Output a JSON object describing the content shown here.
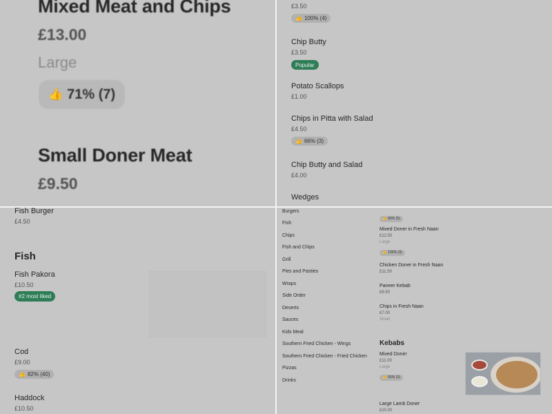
{
  "q1": {
    "item1": {
      "name": "Mixed Meat and Chips",
      "price": "£13.00",
      "size": "Large",
      "rating": "71% (7)"
    },
    "item2": {
      "name": "Small Doner Meat",
      "price": "£9.50"
    }
  },
  "q2": {
    "item0": {
      "price": "£3.50",
      "rating": "100% (4)"
    },
    "item1": {
      "name": "Chip Butty",
      "price": "£3.50",
      "badge": "Popular"
    },
    "item2": {
      "name": "Potato Scallops",
      "price": "£1.00"
    },
    "item3": {
      "name": "Chips in Pitta with Salad",
      "price": "£4.50",
      "rating": "66% (3)"
    },
    "item4": {
      "name": "Chip Butty and Salad",
      "price": "£4.00"
    },
    "item5": {
      "name": "Wedges"
    }
  },
  "q3": {
    "item0": {
      "name": "Fish Burger",
      "price": "£4.50"
    },
    "section": "Fish",
    "item1": {
      "name": "Fish Pakora",
      "price": "£10.50",
      "badge": "#2 most liked"
    },
    "item2": {
      "name": "Cod",
      "price": "£9.00",
      "rating": "82% (40)"
    },
    "item3": {
      "name": "Haddock",
      "price": "£10.50"
    }
  },
  "q4": {
    "sidebar": [
      "Burgers",
      "Fish",
      "Chips",
      "Fish and Chips",
      "Grill",
      "Pies and Pasties",
      "Wraps",
      "Side Order",
      "Deserts",
      "Sauces",
      "Kids Meal",
      "Southern Fried Chicken - Wings",
      "Southern Fried Chicken - Fried Chicken",
      "Pizzas",
      "Drinks"
    ],
    "item0": {
      "rating": "80% (5)"
    },
    "item1": {
      "name": "Mixed Doner in Fresh Naan",
      "price": "£12.50",
      "size": "Large",
      "rating": "100% (3)"
    },
    "item2": {
      "name": "Chicken Doner in Fresh Naan",
      "price": "£11.50"
    },
    "item3": {
      "name": "Paneer Kebab",
      "price": "£9.50"
    },
    "item4": {
      "name": "Chips in Fresh Naan",
      "price": "£7.00",
      "size": "Small"
    },
    "section": "Kebabs",
    "item5": {
      "name": "Mixed Doner",
      "price": "£11.00",
      "size": "Large",
      "rating": "66% (3)"
    },
    "item6": {
      "name": "Large Lamb Doner",
      "price": "£10.00"
    }
  },
  "icons": {
    "thumb": "thumbs-up-icon"
  },
  "colors": {
    "badge_green": "#2e7d57",
    "overlay_gray": "#c6c6c6"
  }
}
